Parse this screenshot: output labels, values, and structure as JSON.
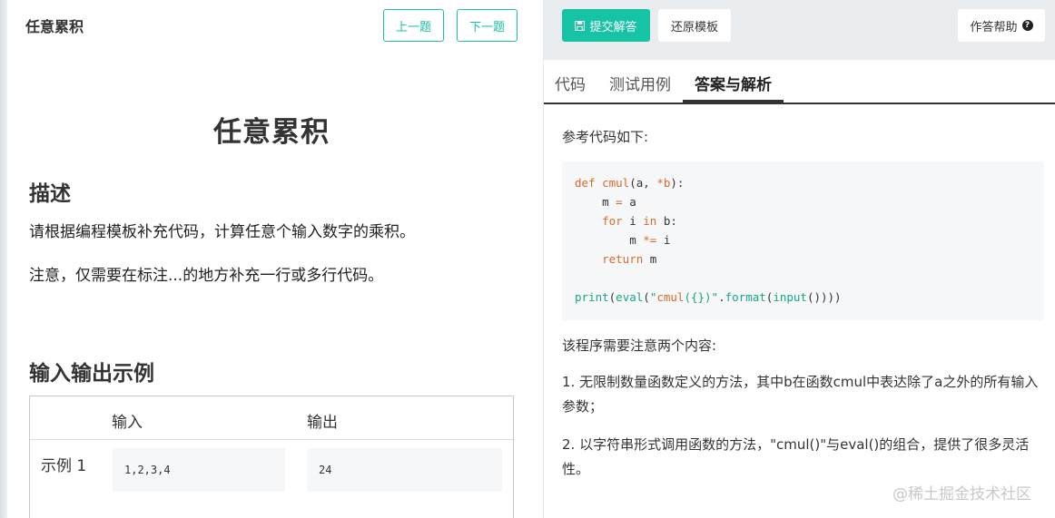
{
  "left": {
    "header_title": "任意累积",
    "prev_label": "上一题",
    "next_label": "下一题",
    "problem_title": "任意累积",
    "desc_heading": "描述",
    "desc_lines": [
      "请根据编程模板补充代码，计算任意个输入数字的乘积。",
      "注意，仅需要在标注...的地方补充一行或多行代码。"
    ],
    "io_heading": "输入输出示例",
    "io_table": {
      "headers": [
        "输入",
        "输出"
      ],
      "rows": [
        {
          "label": "示例 1",
          "input": "1,2,3,4",
          "output": "24"
        }
      ]
    }
  },
  "right": {
    "toolbar": {
      "submit_label": "提交解答",
      "reset_label": "还原模板",
      "help_label": "作答帮助"
    },
    "tabs": [
      {
        "label": "代码",
        "active": false
      },
      {
        "label": "测试用例",
        "active": false
      },
      {
        "label": "答案与解析",
        "active": true
      }
    ],
    "answer_intro": "参考代码如下:",
    "code": [
      "def cmul(a, *b):",
      "    m = a",
      "    for i in b:",
      "        m *= i",
      "    return m",
      "",
      "print(eval(\"cmul({})\".format(input())))"
    ],
    "notes_heading": "该程序需要注意两个内容:",
    "notes": [
      "1. 无限制数量函数定义的方法，其中b在函数cmul中表达除了a之外的所有输入参数；",
      "2. 以字符串形式调用函数的方法，\"cmul()\"与eval()的组合，提供了很多灵活性。"
    ]
  },
  "watermark": "@稀土掘金技术社区",
  "colors": {
    "accent": "#17c3a5",
    "toolbar_bg": "#e9ecef",
    "code_bg": "#f6f7f8",
    "keyword": "#d9692a",
    "builtin": "#17a589"
  },
  "icons": {
    "submit": "save-icon",
    "help": "question-circle-icon",
    "splitter": "drag-handle-icon"
  }
}
